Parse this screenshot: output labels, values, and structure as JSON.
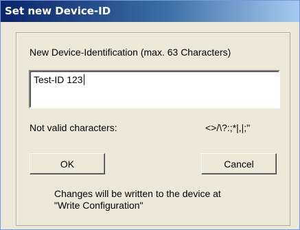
{
  "window": {
    "title": "Set new Device-ID"
  },
  "form": {
    "instruction_label": "New Device-Identification (max. 63 Characters)",
    "device_id_value": "Test-ID 123",
    "invalid_label": "Not valid characters:",
    "invalid_chars": "<>/\\?:;*|,|;\""
  },
  "buttons": {
    "ok_label": "OK",
    "cancel_label": "Cancel"
  },
  "note": {
    "line1": "Changes will be written to the device at",
    "line2": "\"Write Configuration\""
  }
}
